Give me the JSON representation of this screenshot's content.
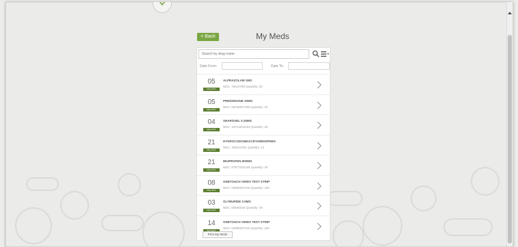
{
  "header": {
    "back_label": "< Back",
    "title": "My Meds"
  },
  "search": {
    "placeholder": "Search by drug name"
  },
  "filters": {
    "date_from_label": "Date From:",
    "date_to_label": "Date To:"
  },
  "meds": [
    {
      "day": "05",
      "month": "May 2017",
      "name": "ALPRAZOLAM 1MG",
      "details": "NDC: 78110789 Quantity: 20"
    },
    {
      "day": "05",
      "month": "May 2017",
      "name": "PREDNISONE 20MG",
      "details": "NDC: 59746017505 Quantity: 10"
    },
    {
      "day": "04",
      "month": "May 2017",
      "name": "SHAROXEL 0.25MG",
      "details": "NDC: 16714044104 Quantity: 25"
    },
    {
      "day": "21",
      "month": "May 2017",
      "name": "HYDROCODONE/ACETAMINOPHEN",
      "details": "NDC: 406012301 Quantity: 12"
    },
    {
      "day": "21",
      "month": "May 2017",
      "name": "IBUPROFEN 800MG",
      "details": "NDC: 67877032105 Quantity: 30"
    },
    {
      "day": "08",
      "month": "May 2017",
      "name": "ONETOUCH VERIO TEST STRIP",
      "details": "NDC: 53885027010 Quantity: 100"
    },
    {
      "day": "03",
      "month": "May 2017",
      "name": "GLYBURIDE 2.5MG",
      "details": "NDC: 00945030 Quantity: 30"
    },
    {
      "day": "14",
      "month": "Feb 2017",
      "name": "ONETOUCH VERIO TEST STRIP",
      "details": "NDC: 53885027010 Quantity: 100"
    }
  ],
  "footer": {
    "print_label": "Print My Meds"
  },
  "colors": {
    "accent": "#7aa642",
    "badge": "#5d7f33"
  },
  "icons": {
    "search": "search-icon",
    "menu": "list-menu-icon",
    "row": "chevron-right-icon",
    "logo": "logo-icon"
  }
}
